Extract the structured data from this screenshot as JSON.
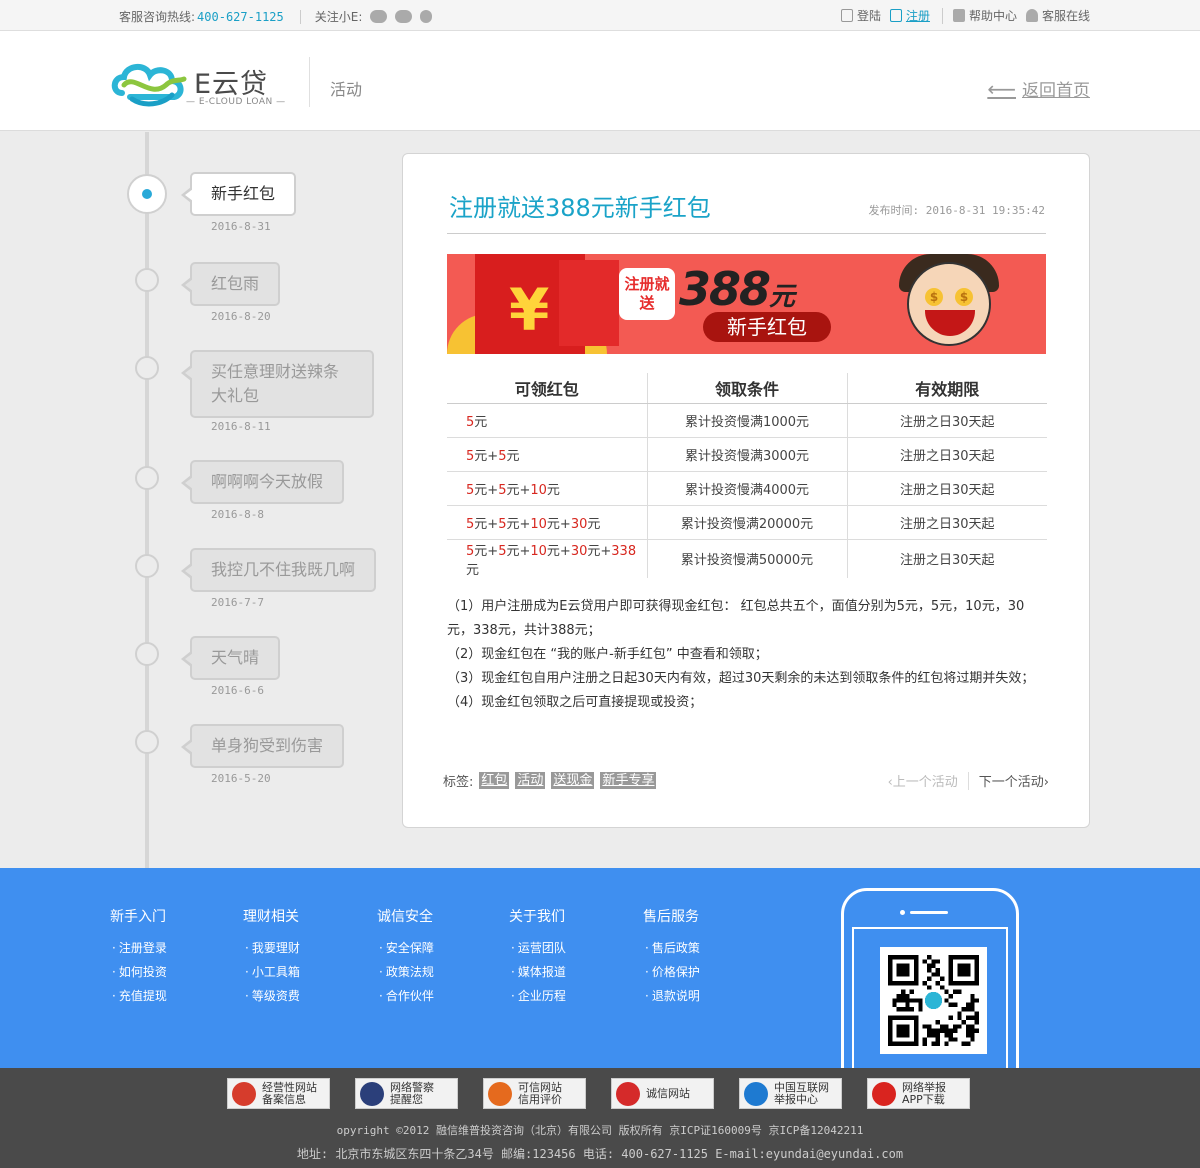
{
  "topbar": {
    "hotline_label": "客服咨询热线:",
    "hotline_number": "400-627-1125",
    "follow_label": "关注小E:",
    "login": "登陆",
    "register": "注册",
    "help": "帮助中心",
    "service": "客服在线"
  },
  "header": {
    "brand": "E云贷",
    "brand_sub": "— E-CLOUD LOAN —",
    "section": "活动",
    "back": "返回首页"
  },
  "timeline": [
    {
      "title": "新手红包",
      "date": "2016-8-31"
    },
    {
      "title": "红包雨",
      "date": "2016-8-20"
    },
    {
      "title": "买任意理财送辣条大礼包",
      "date": "2016-8-11"
    },
    {
      "title": "啊啊啊今天放假",
      "date": "2016-8-8"
    },
    {
      "title": "我控几不住我既几啊",
      "date": "2016-7-7"
    },
    {
      "title": "天气晴",
      "date": "2016-6-6"
    },
    {
      "title": "单身狗受到伤害",
      "date": "2016-5-20"
    }
  ],
  "article": {
    "title": "注册就送388元新手红包",
    "pubtime": "发布时间: 2016-8-31 19:35:42",
    "banner": {
      "tag": "注册就送",
      "amount": "388",
      "amount_unit": "元",
      "sub": "新手红包"
    },
    "table": {
      "headers": [
        "可领红包",
        "领取条件",
        "有效期限"
      ],
      "rows": [
        {
          "reward": [
            "5",
            "元"
          ],
          "cond": "累计投资慢满1000元",
          "valid": "注册之日30天起"
        },
        {
          "reward": [
            "5",
            "元+",
            "5",
            "元"
          ],
          "cond": "累计投资慢满3000元",
          "valid": "注册之日30天起"
        },
        {
          "reward": [
            "5",
            "元+",
            "5",
            "元+",
            "10",
            "元"
          ],
          "cond": "累计投资慢满4000元",
          "valid": "注册之日30天起"
        },
        {
          "reward": [
            "5",
            "元+",
            "5",
            "元+",
            "10",
            "元+",
            "30",
            "元"
          ],
          "cond": "累计投资慢满20000元",
          "valid": "注册之日30天起"
        },
        {
          "reward": [
            "5",
            "元+",
            "5",
            "元+",
            "10",
            "元+",
            "30",
            "元+",
            "338",
            "元"
          ],
          "cond": "累计投资慢满50000元",
          "valid": "注册之日30天起"
        }
      ]
    },
    "notes": [
      "（1）用户注册成为E云贷用户即可获得现金红包： 红包总共五个，面值分别为5元，5元，10元，30元，338元，共计388元；",
      "（2）现金红包在 “我的账户-新手红包” 中查看和领取；",
      "（3）现金红包自用户注册之日起30天内有效，超过30天剩余的未达到领取条件的红包将过期并失效；",
      "（4）现金红包领取之后可直接提现或投资；"
    ],
    "tags_label": "标签:",
    "tags": [
      "红包",
      "活动",
      "送现金",
      "新手专享"
    ],
    "prev": "‹上一个活动",
    "next": "下一个活动›"
  },
  "footer": {
    "columns": [
      {
        "title": "新手入门",
        "items": [
          "注册登录",
          "如何投资",
          "充值提现"
        ]
      },
      {
        "title": "理财相关",
        "items": [
          "我要理财",
          "小工具箱",
          "等级资费"
        ]
      },
      {
        "title": "诚信安全",
        "items": [
          "安全保障",
          "政策法规",
          "合作伙伴"
        ]
      },
      {
        "title": "关于我们",
        "items": [
          "运营团队",
          "媒体报道",
          "企业历程"
        ]
      },
      {
        "title": "售后服务",
        "items": [
          "售后政策",
          "价格保护",
          "退款说明"
        ]
      }
    ],
    "badges": [
      {
        "text": [
          "经营性网站",
          "备案信息"
        ],
        "color": "#d63c2c"
      },
      {
        "text": [
          "网络警察",
          "提醒您"
        ],
        "color": "#2b3f7a"
      },
      {
        "text": [
          "可信网站",
          "信用评价"
        ],
        "color": "#e56a1e"
      },
      {
        "text": [
          "诚信网站"
        ],
        "color": "#d52a2a"
      },
      {
        "text": [
          "中国互联网",
          "举报中心"
        ],
        "color": "#1e7ad1"
      },
      {
        "text": [
          "网络举报",
          "APP下载"
        ],
        "color": "#d9241f"
      }
    ],
    "copyright": "opyright ©2012 融信维普投资咨询（北京）有限公司 版权所有 京ICP证160009号 京ICP备12042211",
    "address": "地址: 北京市东城区东四十条乙34号 邮编:123456 电话: 400-627-1125 E-mail:eyundai@eyundai.com"
  }
}
